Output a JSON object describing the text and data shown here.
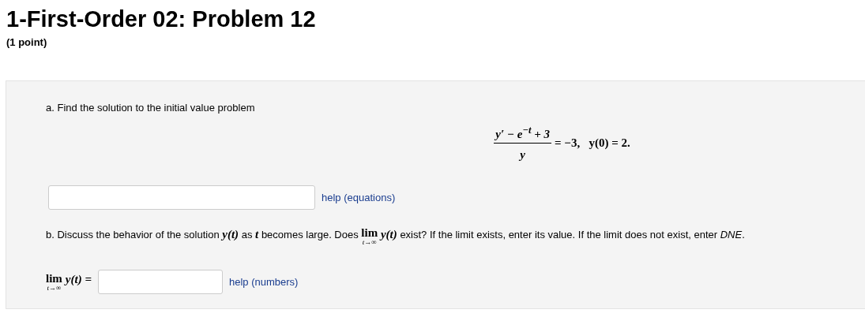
{
  "title": "1-First-Order 02: Problem 12",
  "points": "(1 point)",
  "part_a": {
    "prompt": "a. Find the solution to the initial value problem",
    "equation": {
      "numerator": "y′ − e$^{−t}$ + 3",
      "denominator": "y",
      "rhs": "= −3,   y(0) = 2."
    },
    "help_link": "help (equations)"
  },
  "part_b": {
    "segments": [
      {
        "kind": "text",
        "text": "b. Discuss the behavior of the solution "
      },
      {
        "kind": "math",
        "text": "y(t)"
      },
      {
        "kind": "text",
        "text": " as "
      },
      {
        "kind": "math",
        "text": "t"
      },
      {
        "kind": "text",
        "text": " becomes large. Does "
      },
      {
        "kind": "limit",
        "op": "lim",
        "under": "t→∞"
      },
      {
        "kind": "math",
        "text": " y(t)"
      },
      {
        "kind": "text",
        "text": " exist? If the limit exists, enter its value. If the limit does not exist, enter "
      },
      {
        "kind": "italic",
        "text": "DNE"
      },
      {
        "kind": "text",
        "text": "."
      }
    ],
    "answer_label": {
      "op": "lim",
      "under": "t→∞",
      "expr": "y(t) ="
    },
    "help_link": "help (numbers)"
  }
}
